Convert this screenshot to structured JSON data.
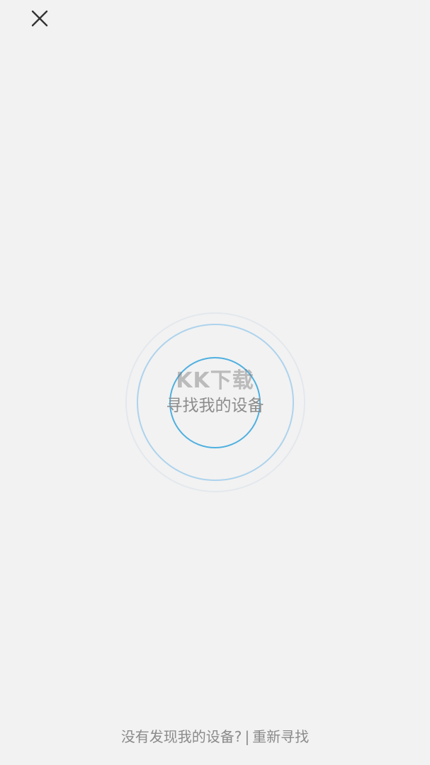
{
  "header": {
    "close_icon": "close-icon"
  },
  "scanner": {
    "watermark": "KK下载",
    "center_label": "寻找我的设备",
    "colors": {
      "inner_ring": "#4fb0e0",
      "mid_ring": "#96c8eb",
      "outer_ring": "#c8d6e4"
    }
  },
  "footer": {
    "question": "没有发现我的设备?",
    "separator": "|",
    "rescan_label": "重新寻找"
  }
}
